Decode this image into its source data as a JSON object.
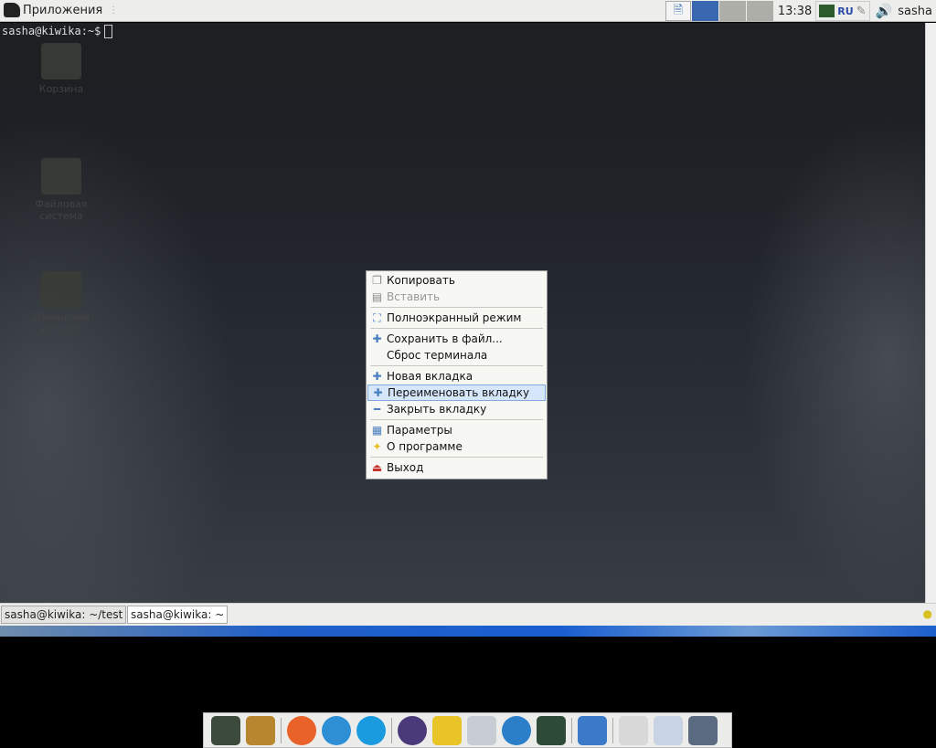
{
  "top_panel": {
    "apps_label": "Приложения",
    "clock": "13:38",
    "layout": "RU",
    "user": "sasha",
    "workspace_colors": [
      "#3a68b0",
      "#aeaea8",
      "#aeaea8"
    ]
  },
  "terminal": {
    "prompt": "sasha@kiwika:~$"
  },
  "desktop_icons": [
    {
      "label": "Корзина"
    },
    {
      "label": "Файловая система"
    },
    {
      "label": "Домашний каталог"
    }
  ],
  "context_menu": {
    "items": [
      {
        "label": "Копировать",
        "icon": "copy-icon",
        "glyph": "❐"
      },
      {
        "label": "Вставить",
        "icon": "paste-icon",
        "glyph": "▤",
        "disabled": true
      },
      {
        "sep": true
      },
      {
        "label": "Полноэкранный режим",
        "icon": "fullscreen-icon",
        "glyph": "⛶"
      },
      {
        "sep": true
      },
      {
        "label": "Сохранить в файл...",
        "icon": "plus-icon",
        "glyph": "✚"
      },
      {
        "label": "Сброс терминала",
        "icon": "",
        "glyph": ""
      },
      {
        "sep": true
      },
      {
        "label": "Новая вкладка",
        "icon": "plus-icon",
        "glyph": "✚"
      },
      {
        "label": "Переименовать вкладку",
        "icon": "plus-icon",
        "glyph": "✚",
        "highlight": true
      },
      {
        "label": "Закрыть вкладку",
        "icon": "minus-icon",
        "glyph": "━"
      },
      {
        "sep": true
      },
      {
        "label": "Параметры",
        "icon": "preferences-icon",
        "glyph": "▦"
      },
      {
        "label": "О программе",
        "icon": "star-icon",
        "glyph": "✦"
      },
      {
        "sep": true
      },
      {
        "label": "Выход",
        "icon": "exit-icon",
        "glyph": "⏏"
      }
    ]
  },
  "tabs": [
    {
      "label": "sasha@kiwika: ~/test"
    },
    {
      "label": "sasha@kiwika: ~",
      "active": true
    }
  ],
  "dock": [
    {
      "name": "terminal",
      "color": "#3c4a3c"
    },
    {
      "name": "file-cabinet",
      "color": "#b8862e"
    },
    {
      "sep": true
    },
    {
      "name": "firefox",
      "color": "#e8622a"
    },
    {
      "name": "telegram",
      "color": "#2f8fd4"
    },
    {
      "name": "skype",
      "color": "#1a9be0"
    },
    {
      "sep": true
    },
    {
      "name": "eclipse",
      "color": "#4a3a7a"
    },
    {
      "name": "teapot",
      "color": "#e8c428"
    },
    {
      "name": "text-editor",
      "color": "#c8ccd4"
    },
    {
      "name": "network",
      "color": "#2a7fc8"
    },
    {
      "name": "installer",
      "color": "#2e4a38"
    },
    {
      "sep": true
    },
    {
      "name": "writer-document",
      "color": "#3a7ac8"
    },
    {
      "sep": true
    },
    {
      "name": "java",
      "color": "#d8d8d8"
    },
    {
      "name": "document-viewer",
      "color": "#c8d4e4"
    },
    {
      "name": "screenshot",
      "color": "#5a6a80"
    }
  ]
}
